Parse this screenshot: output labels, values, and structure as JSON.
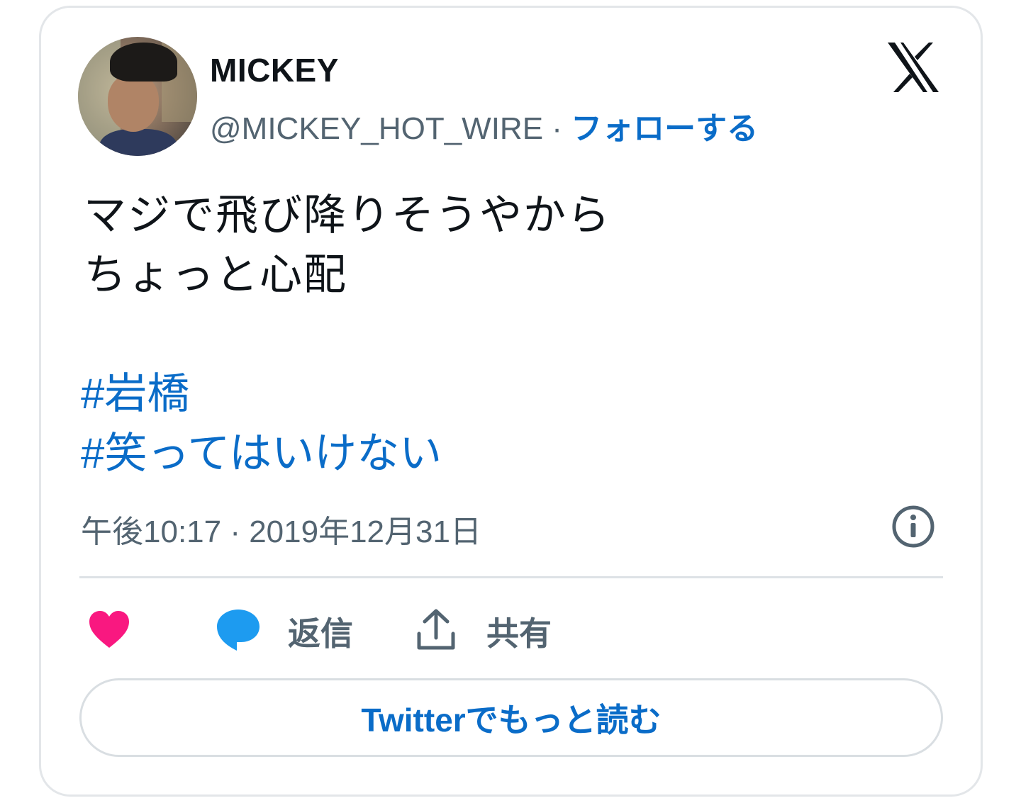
{
  "card": {
    "author": {
      "display_name": "MICKEY",
      "handle": "@MICKEY_HOT_WIRE",
      "separator": " · ",
      "follow_label": "フォローする"
    },
    "brand_icon": "x-logo-icon",
    "text_lines": [
      "マジで飛び降りそうやから",
      "ちょっと心配"
    ],
    "hashtags": [
      "#岩橋",
      "#笑ってはいけない"
    ],
    "timestamp": "午後10:17 · 2019年12月31日",
    "actions": {
      "like_icon": "heart-icon",
      "reply_icon": "speech-bubble-icon",
      "reply_label": "返信",
      "share_icon": "share-upload-icon",
      "share_label": "共有"
    },
    "read_more_label": "Twitterでもっと読む"
  },
  "colors": {
    "accent": "#0a6cc8",
    "heart": "#f91880",
    "reply_bubble": "#1d9bf0",
    "secondary_text": "#536471",
    "primary_text": "#0f1419",
    "border": "#e3e6e9"
  }
}
